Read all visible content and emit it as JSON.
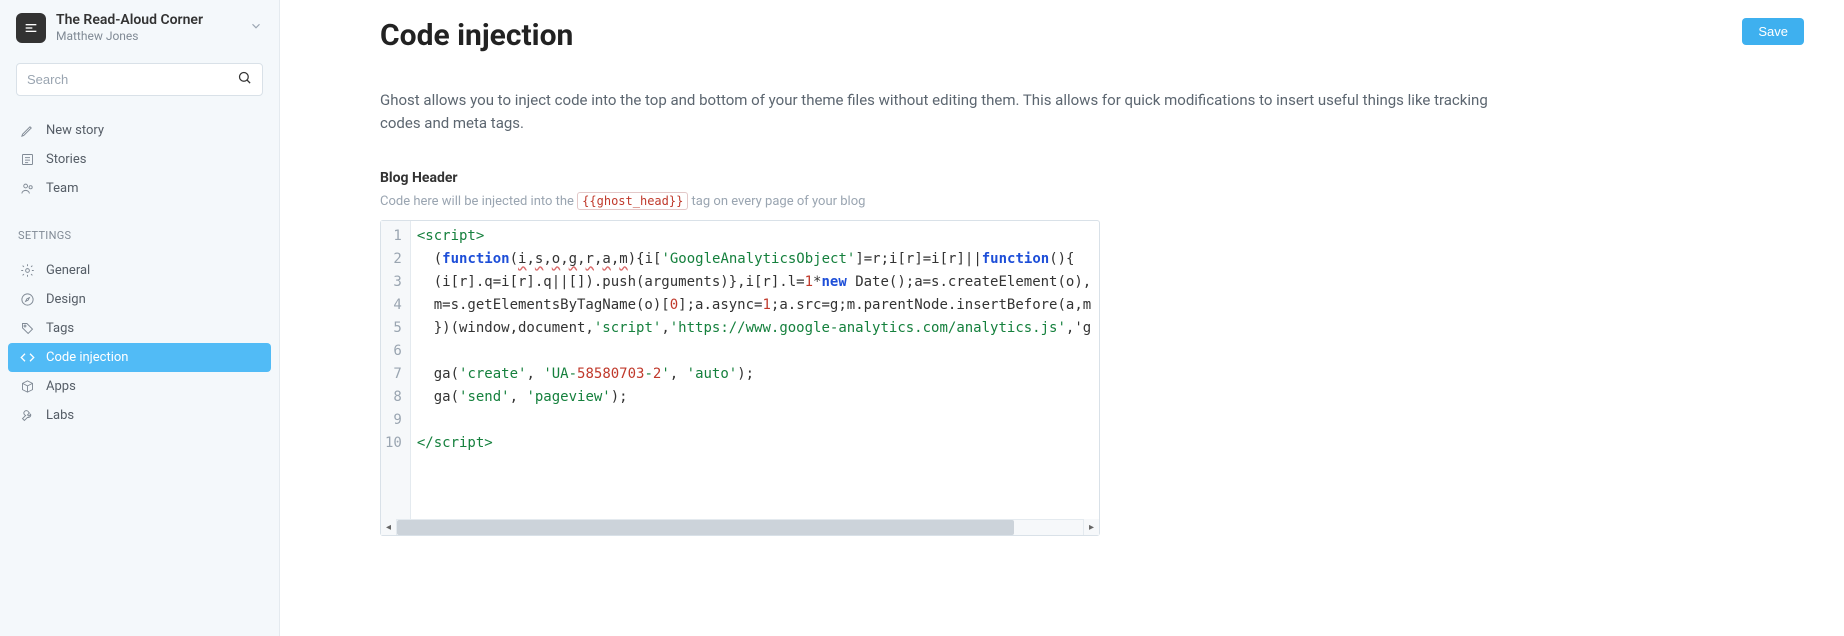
{
  "blog": {
    "title": "The Read-Aloud Corner",
    "author": "Matthew Jones"
  },
  "search": {
    "placeholder": "Search"
  },
  "nav": {
    "content": [
      {
        "key": "new-story",
        "label": "New story"
      },
      {
        "key": "stories",
        "label": "Stories"
      },
      {
        "key": "team",
        "label": "Team"
      }
    ],
    "settings_label": "SETTINGS",
    "settings": [
      {
        "key": "general",
        "label": "General"
      },
      {
        "key": "design",
        "label": "Design"
      },
      {
        "key": "tags",
        "label": "Tags"
      },
      {
        "key": "code-injection",
        "label": "Code injection",
        "active": true
      },
      {
        "key": "apps",
        "label": "Apps"
      },
      {
        "key": "labs",
        "label": "Labs"
      }
    ]
  },
  "page": {
    "title": "Code injection",
    "save_label": "Save",
    "description": "Ghost allows you to inject code into the top and bottom of your theme files without editing them. This allows for quick modifications to insert useful things like tracking codes and meta tags."
  },
  "header_section": {
    "title": "Blog Header",
    "help_prefix": "Code here will be injected into the ",
    "help_tag": "{{ghost_head}}",
    "help_suffix": " tag on every page of your blog"
  },
  "code": {
    "line_numbers": [
      "1",
      "2",
      "3",
      "4",
      "5",
      "6",
      "7",
      "8",
      "9",
      "10"
    ],
    "lines": [
      "<script>",
      "  (function(i,s,o,g,r,a,m){i['GoogleAnalyticsObject']=r;i[r]=i[r]||function(){",
      "  (i[r].q=i[r].q||[]).push(arguments)},i[r].l=1*new Date();a=s.createElement(o),",
      "  m=s.getElementsByTagName(o)[0];a.async=1;a.src=g;m.parentNode.insertBefore(a,m",
      "  })(window,document,'script','https://www.google-analytics.com/analytics.js','g",
      "",
      "  ga('create', 'UA-58580703-2', 'auto');",
      "  ga('send', 'pageview');",
      "",
      "</script>"
    ]
  }
}
